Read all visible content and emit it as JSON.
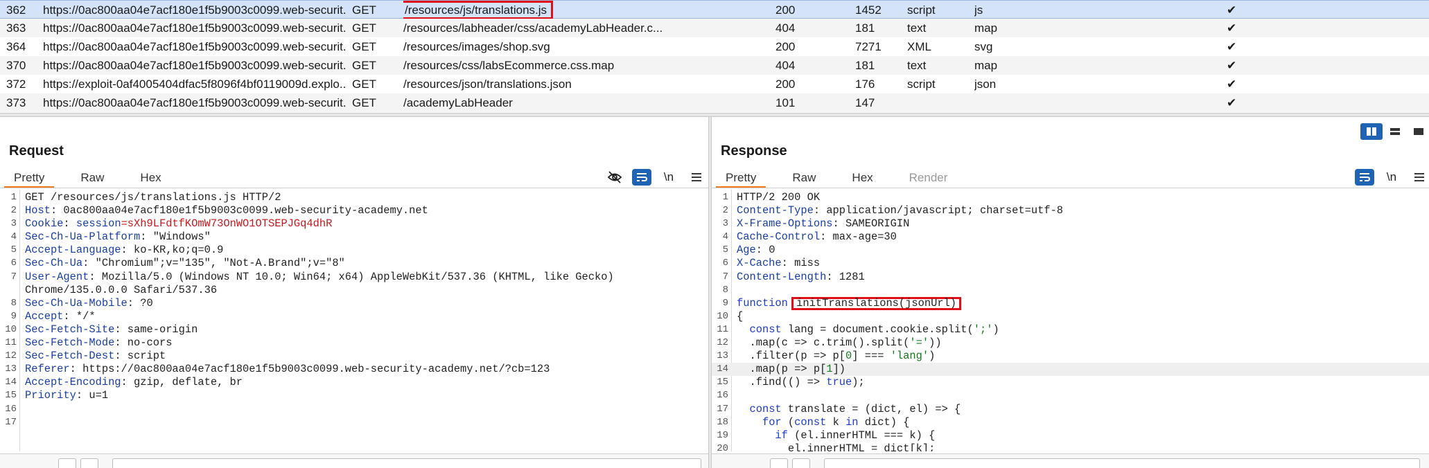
{
  "table": {
    "rows": [
      {
        "num": "362",
        "host": "https://0ac800aa04e7acf180e1f5b9003c0099.web-securit...",
        "method": "GET",
        "url": "/resources/js/translations.js",
        "status": "200",
        "length": "1452",
        "mime": "script",
        "ext": "js",
        "check": "✔",
        "selected": true,
        "highlight": true
      },
      {
        "num": "363",
        "host": "https://0ac800aa04e7acf180e1f5b9003c0099.web-securit...",
        "method": "GET",
        "url": "/resources/labheader/css/academyLabHeader.c...",
        "status": "404",
        "length": "181",
        "mime": "text",
        "ext": "map",
        "check": "✔"
      },
      {
        "num": "364",
        "host": "https://0ac800aa04e7acf180e1f5b9003c0099.web-securit...",
        "method": "GET",
        "url": "/resources/images/shop.svg",
        "status": "200",
        "length": "7271",
        "mime": "XML",
        "ext": "svg",
        "check": "✔"
      },
      {
        "num": "370",
        "host": "https://0ac800aa04e7acf180e1f5b9003c0099.web-securit...",
        "method": "GET",
        "url": "/resources/css/labsEcommerce.css.map",
        "status": "404",
        "length": "181",
        "mime": "text",
        "ext": "map",
        "check": "✔"
      },
      {
        "num": "372",
        "host": "https://exploit-0af4005404dfac5f8096f4bf0119009d.explo...",
        "method": "GET",
        "url": "/resources/json/translations.json",
        "status": "200",
        "length": "176",
        "mime": "script",
        "ext": "json",
        "check": "✔"
      },
      {
        "num": "373",
        "host": "https://0ac800aa04e7acf180e1f5b9003c0099.web-securit...",
        "method": "GET",
        "url": "/academyLabHeader",
        "status": "101",
        "length": "147",
        "mime": "",
        "ext": "",
        "check": "✔"
      }
    ]
  },
  "request": {
    "title": "Request",
    "tabs": [
      "Pretty",
      "Raw",
      "Hex"
    ],
    "active_tab": "Pretty",
    "tools": {
      "hide_icon": "eye-slash-icon",
      "wrap_icon": "wrap-icon",
      "newline": "\\n",
      "menu_icon": "hamburger-icon"
    },
    "lines": [
      {
        "n": "1",
        "parts": [
          {
            "t": "GET /resources/js/translations.js HTTP/2",
            "c": "plain"
          }
        ]
      },
      {
        "n": "2",
        "parts": [
          {
            "t": "Host",
            "c": "hn"
          },
          {
            "t": ": 0ac800aa04e7acf180e1f5b9003c0099.web-security-academy.net",
            "c": "hv"
          }
        ]
      },
      {
        "n": "3",
        "parts": [
          {
            "t": "Cookie",
            "c": "hn"
          },
          {
            "t": ": ",
            "c": "hv"
          },
          {
            "t": "session",
            "c": "hn"
          },
          {
            "t": "=sXh9LFdtfKOmW73OnWO1OTSEPJGq4dhR",
            "c": "ck"
          }
        ]
      },
      {
        "n": "4",
        "parts": [
          {
            "t": "Sec-Ch-Ua-Platform",
            "c": "hn"
          },
          {
            "t": ": \"Windows\"",
            "c": "hv"
          }
        ]
      },
      {
        "n": "5",
        "parts": [
          {
            "t": "Accept-Language",
            "c": "hn"
          },
          {
            "t": ": ko-KR,ko;q=0.9",
            "c": "hv"
          }
        ]
      },
      {
        "n": "6",
        "parts": [
          {
            "t": "Sec-Ch-Ua",
            "c": "hn"
          },
          {
            "t": ": \"Chromium\";v=\"135\", \"Not-A.Brand\";v=\"8\"",
            "c": "hv"
          }
        ]
      },
      {
        "n": "7",
        "parts": [
          {
            "t": "User-Agent",
            "c": "hn"
          },
          {
            "t": ": Mozilla/5.0 (Windows NT 10.0; Win64; x64) AppleWebKit/537.36 (KHTML, like Gecko)",
            "c": "hv"
          }
        ]
      },
      {
        "n": "",
        "parts": [
          {
            "t": "Chrome/135.0.0.0 Safari/537.36",
            "c": "hv"
          }
        ]
      },
      {
        "n": "8",
        "parts": [
          {
            "t": "Sec-Ch-Ua-Mobile",
            "c": "hn"
          },
          {
            "t": ": ?0",
            "c": "hv"
          }
        ]
      },
      {
        "n": "9",
        "parts": [
          {
            "t": "Accept",
            "c": "hn"
          },
          {
            "t": ": */*",
            "c": "hv"
          }
        ]
      },
      {
        "n": "10",
        "parts": [
          {
            "t": "Sec-Fetch-Site",
            "c": "hn"
          },
          {
            "t": ": same-origin",
            "c": "hv"
          }
        ]
      },
      {
        "n": "11",
        "parts": [
          {
            "t": "Sec-Fetch-Mode",
            "c": "hn"
          },
          {
            "t": ": no-cors",
            "c": "hv"
          }
        ]
      },
      {
        "n": "12",
        "parts": [
          {
            "t": "Sec-Fetch-Dest",
            "c": "hn"
          },
          {
            "t": ": script",
            "c": "hv"
          }
        ]
      },
      {
        "n": "13",
        "parts": [
          {
            "t": "Referer",
            "c": "hn"
          },
          {
            "t": ": https://0ac800aa04e7acf180e1f5b9003c0099.web-security-academy.net/?cb=123",
            "c": "hv"
          }
        ]
      },
      {
        "n": "14",
        "parts": [
          {
            "t": "Accept-Encoding",
            "c": "hn"
          },
          {
            "t": ": gzip, deflate, br",
            "c": "hv"
          }
        ]
      },
      {
        "n": "15",
        "parts": [
          {
            "t": "Priority",
            "c": "hn"
          },
          {
            "t": ": u=1",
            "c": "hv"
          }
        ]
      },
      {
        "n": "16",
        "parts": []
      },
      {
        "n": "17",
        "parts": []
      }
    ]
  },
  "response": {
    "title": "Response",
    "tabs": [
      "Pretty",
      "Raw",
      "Hex",
      "Render"
    ],
    "active_tab": "Pretty",
    "disabled_tab": "Render",
    "tools": {
      "wrap_icon": "wrap-icon",
      "newline": "\\n",
      "menu_icon": "hamburger-icon"
    },
    "lines": [
      {
        "n": "1",
        "parts": [
          {
            "t": "HTTP/2 200 OK",
            "c": "plain"
          }
        ]
      },
      {
        "n": "2",
        "parts": [
          {
            "t": "Content-Type",
            "c": "hn"
          },
          {
            "t": ": application/javascript; charset=utf-8",
            "c": "hv"
          }
        ]
      },
      {
        "n": "3",
        "parts": [
          {
            "t": "X-Frame-Options",
            "c": "hn"
          },
          {
            "t": ": SAMEORIGIN",
            "c": "hv"
          }
        ]
      },
      {
        "n": "4",
        "parts": [
          {
            "t": "Cache-Control",
            "c": "hn"
          },
          {
            "t": ": max-age=30",
            "c": "hv"
          }
        ]
      },
      {
        "n": "5",
        "parts": [
          {
            "t": "Age",
            "c": "hn"
          },
          {
            "t": ": 0",
            "c": "hv"
          }
        ]
      },
      {
        "n": "6",
        "parts": [
          {
            "t": "X-Cache",
            "c": "hn"
          },
          {
            "t": ": miss",
            "c": "hv"
          }
        ]
      },
      {
        "n": "7",
        "parts": [
          {
            "t": "Content-Length",
            "c": "hn"
          },
          {
            "t": ": 1281",
            "c": "hv"
          }
        ]
      },
      {
        "n": "8",
        "parts": []
      },
      {
        "n": "9",
        "parts": [
          {
            "t": "function",
            "c": "kw"
          },
          {
            "t": " ",
            "c": "plain"
          },
          {
            "t": "initTranslations(jsonUrl)",
            "c": "plain",
            "hl": true
          }
        ]
      },
      {
        "n": "10",
        "parts": [
          {
            "t": "{",
            "c": "plain"
          }
        ]
      },
      {
        "n": "11",
        "parts": [
          {
            "t": "  ",
            "c": "plain"
          },
          {
            "t": "const",
            "c": "kw"
          },
          {
            "t": " lang = document.cookie.split(",
            "c": "plain"
          },
          {
            "t": "';'",
            "c": "str"
          },
          {
            "t": ")",
            "c": "plain"
          }
        ]
      },
      {
        "n": "12",
        "parts": [
          {
            "t": "  .map(c => c.trim().split(",
            "c": "plain"
          },
          {
            "t": "'='",
            "c": "str"
          },
          {
            "t": "))",
            "c": "plain"
          }
        ]
      },
      {
        "n": "13",
        "parts": [
          {
            "t": "  .filter(p => p[",
            "c": "plain"
          },
          {
            "t": "0",
            "c": "num"
          },
          {
            "t": "] === ",
            "c": "plain"
          },
          {
            "t": "'lang'",
            "c": "str"
          },
          {
            "t": ")",
            "c": "plain"
          }
        ]
      },
      {
        "n": "14",
        "parts": [
          {
            "t": "  .map(p => p[",
            "c": "plain"
          },
          {
            "t": "1",
            "c": "num"
          },
          {
            "t": "])",
            "c": "plain"
          }
        ],
        "current": true
      },
      {
        "n": "15",
        "parts": [
          {
            "t": "  .find(() => ",
            "c": "plain"
          },
          {
            "t": "true",
            "c": "kw"
          },
          {
            "t": ");",
            "c": "plain"
          }
        ]
      },
      {
        "n": "16",
        "parts": []
      },
      {
        "n": "17",
        "parts": [
          {
            "t": "  ",
            "c": "plain"
          },
          {
            "t": "const",
            "c": "kw"
          },
          {
            "t": " translate = (dict, el) => {",
            "c": "plain"
          }
        ]
      },
      {
        "n": "18",
        "parts": [
          {
            "t": "    ",
            "c": "plain"
          },
          {
            "t": "for",
            "c": "kw"
          },
          {
            "t": " (",
            "c": "plain"
          },
          {
            "t": "const",
            "c": "kw"
          },
          {
            "t": " k ",
            "c": "plain"
          },
          {
            "t": "in",
            "c": "kw"
          },
          {
            "t": " dict) {",
            "c": "plain"
          }
        ]
      },
      {
        "n": "19",
        "parts": [
          {
            "t": "      ",
            "c": "plain"
          },
          {
            "t": "if",
            "c": "kw"
          },
          {
            "t": " (el.innerHTML === k) {",
            "c": "plain"
          }
        ]
      },
      {
        "n": "20",
        "parts": [
          {
            "t": "        el.innerHTML = dict[k];",
            "c": "plain"
          }
        ]
      }
    ]
  },
  "layout_buttons": [
    {
      "name": "split-vertical-icon",
      "active": true
    },
    {
      "name": "split-horizontal-icon",
      "active": false
    },
    {
      "name": "single-pane-icon",
      "active": false
    }
  ],
  "colors": {
    "accent": "#f37b1d",
    "selection": "#d4e3f8",
    "highlight_box": "#e0101a",
    "button_blue": "#1f63b5"
  }
}
